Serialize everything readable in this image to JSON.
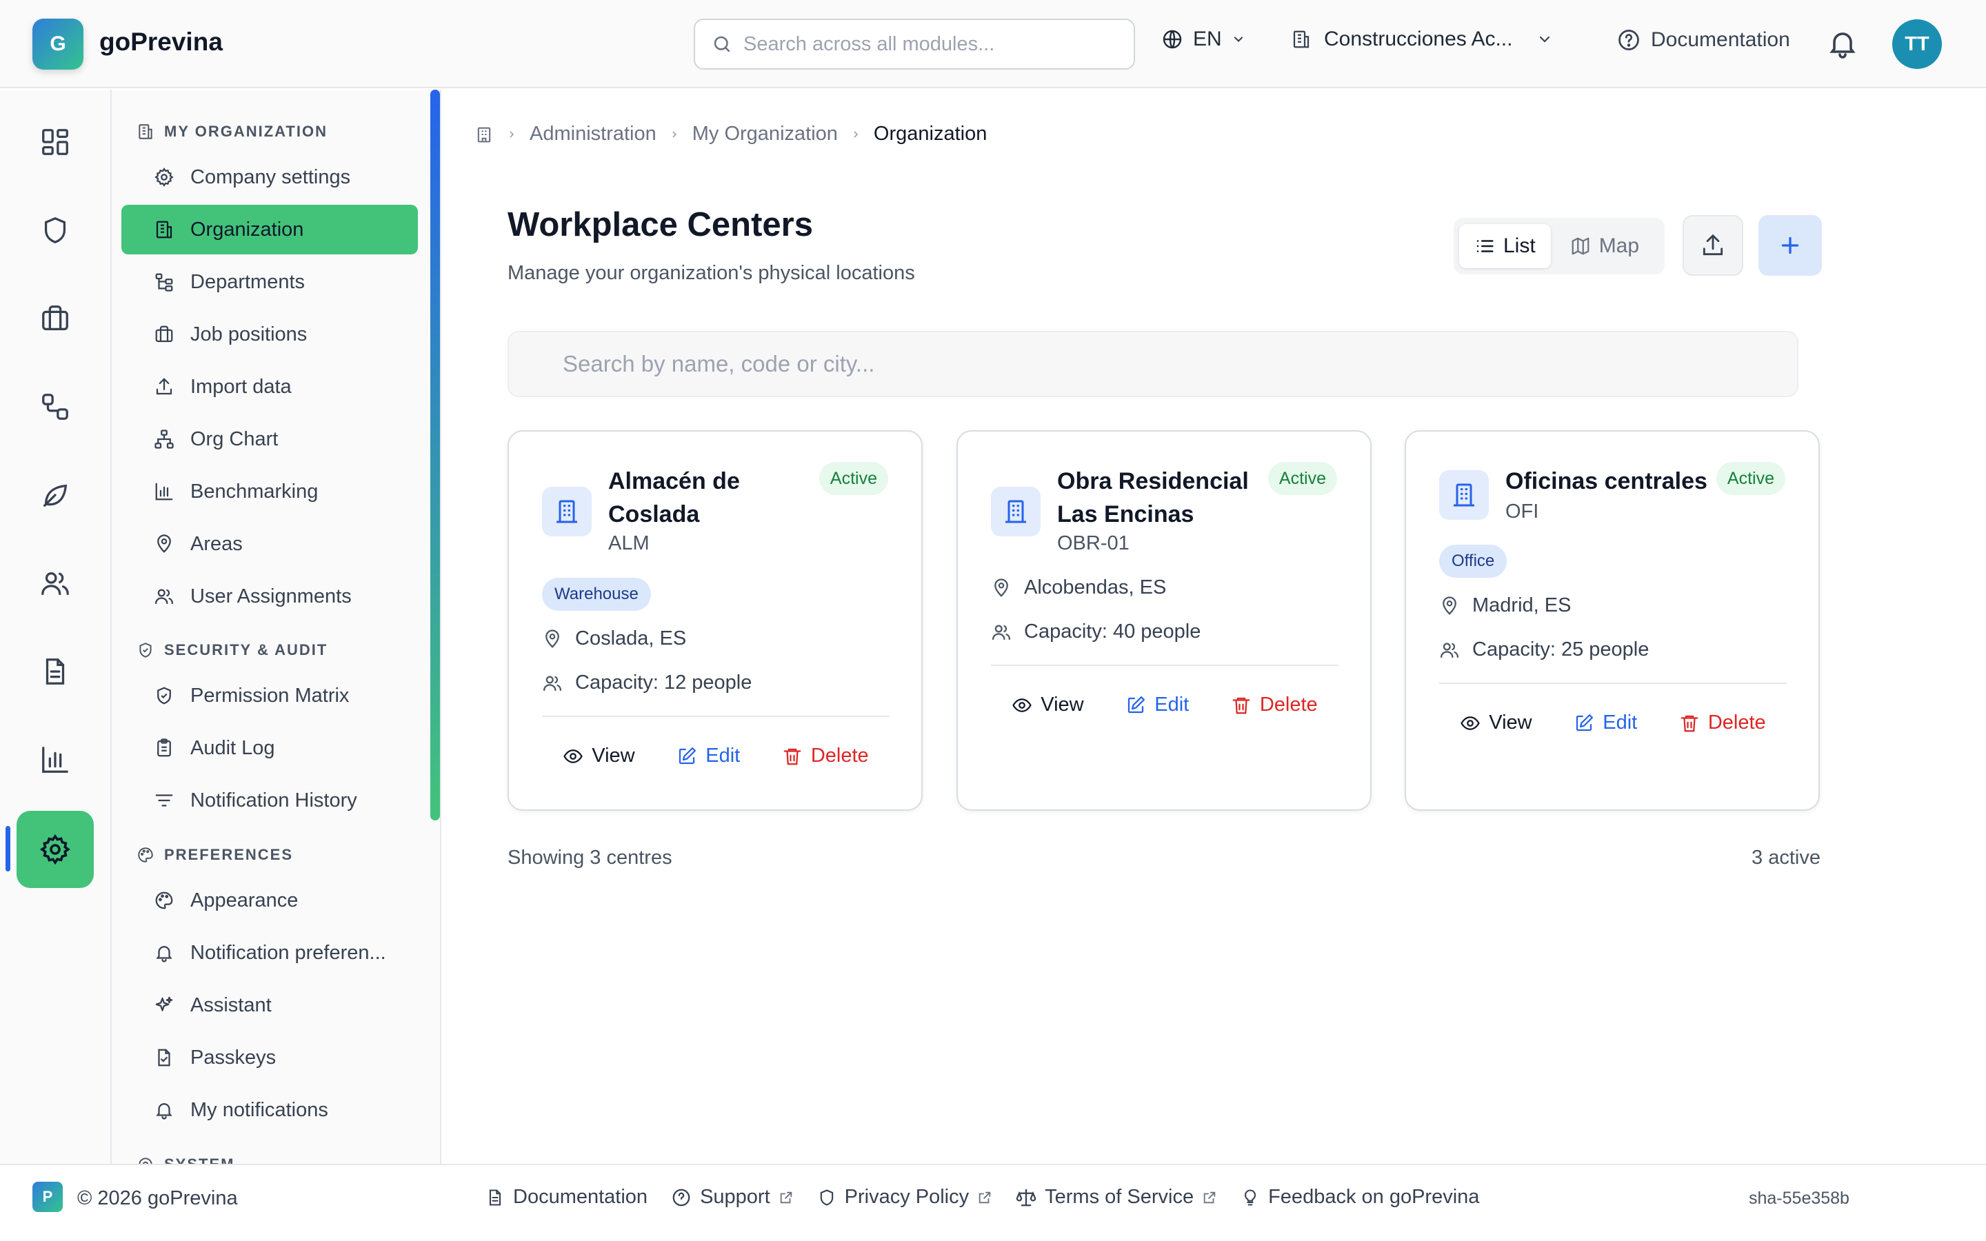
{
  "app": {
    "logo_letter": "G",
    "name": "goPrevina"
  },
  "header": {
    "search_placeholder": "Search across all modules...",
    "language": "EN",
    "company": "Construcciones Ac...",
    "docs_label": "Documentation",
    "avatar_initials": "TT"
  },
  "rail": {
    "items": [
      "dashboard-icon",
      "shield-icon",
      "briefcase-icon",
      "workflow-icon",
      "leaf-icon",
      "users-icon",
      "document-icon",
      "bar-chart-icon",
      "settings-icon"
    ],
    "active": "settings-icon"
  },
  "sidebar": {
    "sections": [
      {
        "title": "MY ORGANIZATION",
        "items": [
          "Company settings",
          "Organization",
          "Departments",
          "Job positions",
          "Import data",
          "Org Chart",
          "Benchmarking",
          "Areas",
          "User Assignments"
        ]
      },
      {
        "title": "SECURITY & AUDIT",
        "items": [
          "Permission Matrix",
          "Audit Log",
          "Notification History"
        ]
      },
      {
        "title": "PREFERENCES",
        "items": [
          "Appearance",
          "Notification preferen...",
          "Assistant",
          "Passkeys",
          "My notifications"
        ]
      },
      {
        "title": "SYSTEM",
        "items": []
      }
    ],
    "active_item": "Organization"
  },
  "breadcrumb": [
    "Administration",
    "My Organization",
    "Organization"
  ],
  "page": {
    "title": "Workplace Centers",
    "subtitle": "Manage your organization's physical locations",
    "view_list": "List",
    "view_map": "Map",
    "search_placeholder": "Search by name, code or city..."
  },
  "centers": [
    {
      "name": "Almacén de Coslada",
      "code": "ALM",
      "status": "Active",
      "type": "Warehouse",
      "location": "Coslada, ES",
      "capacity": "Capacity: 12 people"
    },
    {
      "name": "Obra Residencial Las Encinas",
      "code": "OBR-01",
      "status": "Active",
      "type": "",
      "location": "Alcobendas, ES",
      "capacity": "Capacity: 40 people"
    },
    {
      "name": "Oficinas centrales",
      "code": "OFI",
      "status": "Active",
      "type": "Office",
      "location": "Madrid, ES",
      "capacity": "Capacity: 25 people"
    }
  ],
  "actions": {
    "view": "View",
    "edit": "Edit",
    "delete": "Delete"
  },
  "summary": {
    "showing": "Showing 3 centres",
    "active": "3 active"
  },
  "footer": {
    "logo_letter": "P",
    "copyright": "© 2026 goPrevina",
    "links": [
      "Documentation",
      "Support",
      "Privacy Policy",
      "Terms of Service",
      "Feedback on goPrevina"
    ],
    "sha": "sha-55e358b"
  },
  "colors": {
    "accent_green": "#43c37a",
    "accent_blue": "#2563eb",
    "danger": "#dc2626",
    "active_badge_bg": "#e7f8ec"
  }
}
